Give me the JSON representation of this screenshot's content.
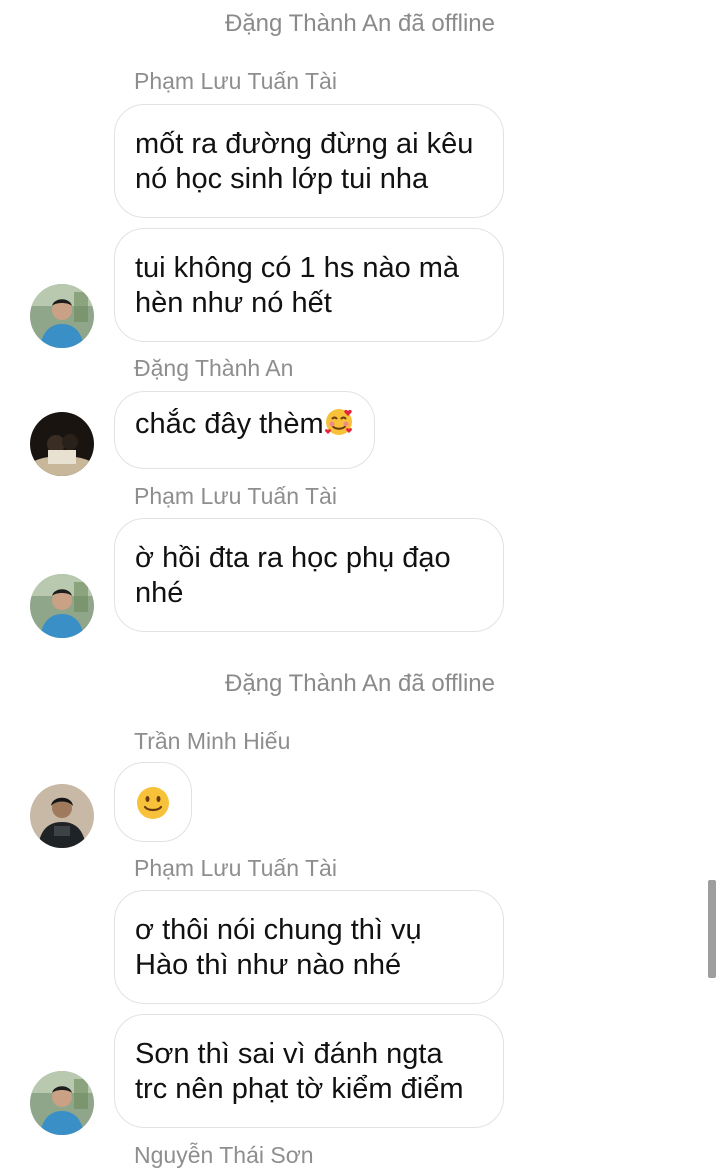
{
  "messages": [
    {
      "type": "system",
      "text": "Đặng Thành An đã offline"
    },
    {
      "type": "sender",
      "text": "Phạm Lưu Tuấn Tài"
    },
    {
      "type": "bubble",
      "lines": [
        "mốt ra đường đừng ai kêu",
        "nó học sinh lớp tui nha"
      ]
    },
    {
      "type": "bubble",
      "lines": [
        "tui không có 1 hs nào mà",
        "hèn như nó hết"
      ]
    },
    {
      "type": "sender",
      "text": "Đặng Thành An"
    },
    {
      "type": "bubble",
      "text": "chắc đây thèm",
      "emoji": "smiling-face-with-hearts"
    },
    {
      "type": "sender",
      "text": "Phạm Lưu Tuấn Tài"
    },
    {
      "type": "bubble",
      "lines": [
        "ờ hồi đta ra học phụ đạo",
        "nhé"
      ]
    },
    {
      "type": "system",
      "text": "Đặng Thành An đã offline"
    },
    {
      "type": "sender",
      "text": "Trần Minh Hiếu"
    },
    {
      "type": "bubble",
      "emoji": "slightly-smiling-face"
    },
    {
      "type": "sender",
      "text": "Phạm Lưu Tuấn Tài"
    },
    {
      "type": "bubble",
      "lines": [
        "ơ thôi nói chung thì vụ",
        "Hào thì như nào nhé"
      ]
    },
    {
      "type": "bubble",
      "lines": [
        "Sơn thì sai vì đánh ngta",
        "trc nên phạt tờ kiểm điểm"
      ]
    },
    {
      "type": "sender",
      "text": "Nguyễn Thái Sơn"
    }
  ],
  "avatars": {
    "tai": "photo-avatar-blue-shirt",
    "an": "photo-avatar-dark",
    "hieu": "photo-avatar-dark-jacket"
  },
  "colors": {
    "background": "#ffffff",
    "bubble_border": "#e2e2e2",
    "meta_text": "#8e8e8e",
    "message_text": "#111111"
  }
}
